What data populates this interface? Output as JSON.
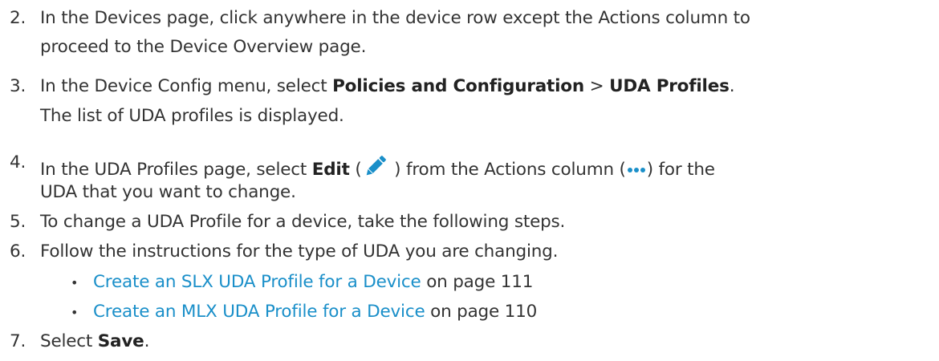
{
  "steps": [
    {
      "number": "2.",
      "line1": "In the Devices page, click anywhere in the device row except the Actions column to",
      "line2": "proceed to the Device Overview page."
    },
    {
      "number": "3.",
      "pre": "In the Device Config menu, select ",
      "bold1": "Policies and Configuration",
      "sep": " > ",
      "bold2": "UDA Profiles",
      "end": ".",
      "line2": "The list of UDA profiles is displayed."
    },
    {
      "number": "4.",
      "pre": "In the UDA Profiles page, select ",
      "bold": "Edit",
      "paren_open": " (",
      "mid": " ) from the Actions column (",
      "post": ") for the",
      "line2": "UDA that you want to change."
    },
    {
      "number": "5.",
      "line1": "To change a UDA Profile for a device, take the following steps."
    },
    {
      "number": "6.",
      "line1": "Follow the instructions for the type of UDA you are changing."
    },
    {
      "number": "7.",
      "pre": "Select ",
      "bold": "Save",
      "end": "."
    }
  ],
  "links": [
    {
      "bullet": "•",
      "text": "Create an SLX UDA Profile for a Device",
      "suffix": " on page 111"
    },
    {
      "bullet": "•",
      "text": "Create an MLX UDA Profile for a Device",
      "suffix": " on page 110"
    }
  ],
  "icons": {
    "edit": "pencil-icon",
    "actions": "more-dots-icon",
    "accent_color": "#1a8fc9"
  }
}
